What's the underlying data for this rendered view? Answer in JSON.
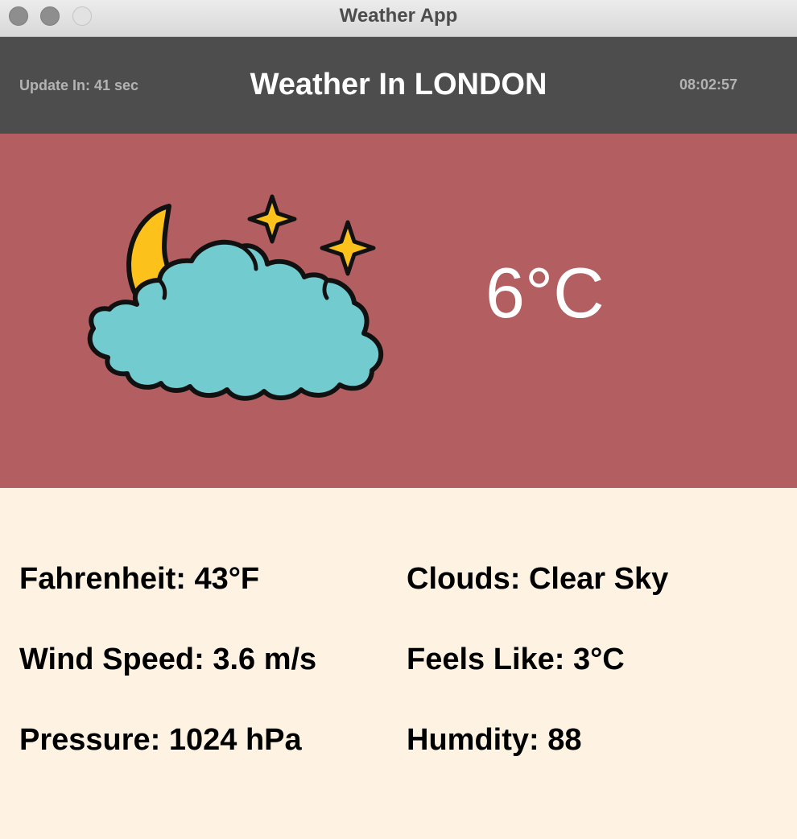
{
  "window": {
    "title": "Weather App"
  },
  "header": {
    "update_in": "Update In: 41 sec",
    "city_title": "Weather In LONDON",
    "clock": "08:02:57"
  },
  "current": {
    "icon": "cloud-moon-stars-icon",
    "temperature": "6°C"
  },
  "details": {
    "fahrenheit": "Fahrenheit: 43°F",
    "clouds": "Clouds: Clear Sky",
    "wind_speed": "Wind Speed: 3.6 m/s",
    "feels_like": "Feels Like: 3°C",
    "pressure": "Pressure: 1024 hPa",
    "humidity": "Humdity: 88"
  },
  "colors": {
    "header_bg": "#4d4d4d",
    "main_bg": "#b35f61",
    "details_bg": "#fef3e2",
    "cloud": "#72cbcf",
    "moon_star": "#fcc21b"
  }
}
